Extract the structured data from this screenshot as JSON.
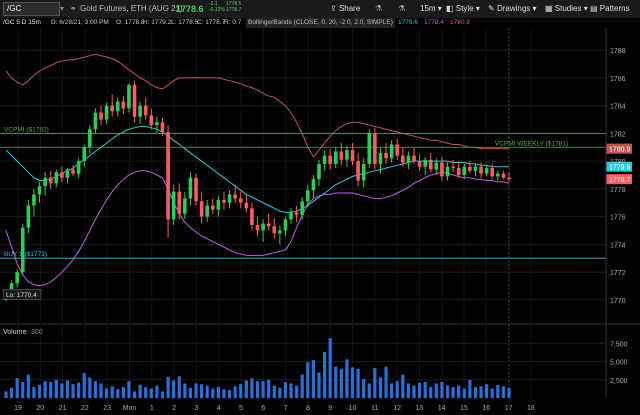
{
  "toolbar": {
    "symbol": "/GC",
    "description": "Gold Futures, ETH (AUG 21)",
    "last_price": "1778.6",
    "change_top": "-2.1",
    "change_bottom": "-0.12%",
    "bid": "1778.5",
    "ask": "1778.7",
    "share_label": "Share",
    "interval_label": "15m",
    "style_label": "Style",
    "drawings_label": "Drawings",
    "studies_label": "Studies",
    "patterns_label": "Patterns"
  },
  "ohlc_bar": {
    "symbol_interval": "/GC 5 D 15m",
    "date": "D: 6/28/21, 3:00 PM",
    "open": "O: 1778.8",
    "high": "H: 1779.2",
    "low": "L: 1778.5",
    "close": "C: 1778.7",
    "range": "R: 0.7",
    "study": "BollingerBands (CLOSE, 0, 20, -2.0, 2.0, SIMPLE)",
    "bb_mid": "1779.6",
    "bb_low": "1778.4",
    "bb_up": "1780.9"
  },
  "colors": {
    "up": "#2ecc52",
    "down": "#ff5d5d",
    "upper_band": "#c0574f",
    "mid_band": "#30c8d8",
    "lower_band": "#c060e0",
    "vcpmi": "#5fae3a",
    "buy_line": "#30c8d8",
    "volume": "#2c6fd6"
  },
  "chart_data": {
    "type": "candlestick",
    "yaxis_ticks": [
      1770,
      1772,
      1774,
      1776,
      1778,
      1780,
      1782,
      1784,
      1786,
      1788
    ],
    "ylim": [
      1768.4,
      1789.6
    ],
    "xaxis_ticks": [
      "19",
      "20",
      "21",
      "22",
      "23",
      "Mon",
      "1",
      "2",
      "3",
      "4",
      "5",
      "6",
      "7",
      "8",
      "9",
      "10",
      "11",
      "12",
      "13",
      "14",
      "15",
      "16",
      "17",
      "18"
    ],
    "levels": [
      {
        "label": "VCPMI ($1782)",
        "value": 1782
      },
      {
        "label": "VCPMI WEEKLY ($1781)",
        "value": 1781
      },
      {
        "label": "BUY 1 ($1773)",
        "value": 1773
      }
    ],
    "low_label": "Lo: 1770.4",
    "low_value": 1770.4,
    "price_tags": [
      {
        "value": 1780.9,
        "text": "1780.9",
        "color": "#c0574f"
      },
      {
        "value": 1779.6,
        "text": "1779.6",
        "color": "#30c8d8"
      },
      {
        "value": 1778.7,
        "text": "1778.7",
        "color": "#ff5d5d"
      }
    ],
    "candles": [
      [
        1770.0,
        1770.8,
        1769.9,
        1770.6
      ],
      [
        1770.6,
        1771.4,
        1770.4,
        1771.2
      ],
      [
        1771.2,
        1772.2,
        1770.9,
        1772.0
      ],
      [
        1772.0,
        1775.5,
        1771.8,
        1775.2
      ],
      [
        1775.2,
        1777.2,
        1774.8,
        1776.8
      ],
      [
        1776.8,
        1778.0,
        1776.0,
        1777.6
      ],
      [
        1777.6,
        1778.5,
        1777.0,
        1778.2
      ],
      [
        1778.2,
        1779.2,
        1777.5,
        1778.8
      ],
      [
        1778.8,
        1779.3,
        1778.0,
        1778.4
      ],
      [
        1778.4,
        1779.4,
        1778.1,
        1779.2
      ],
      [
        1779.2,
        1779.6,
        1778.5,
        1778.8
      ],
      [
        1778.8,
        1779.5,
        1778.4,
        1779.4
      ],
      [
        1779.4,
        1779.7,
        1778.9,
        1779.1
      ],
      [
        1779.1,
        1780.2,
        1778.8,
        1780.0
      ],
      [
        1780.0,
        1781.2,
        1779.6,
        1781.0
      ],
      [
        1781.0,
        1782.6,
        1780.5,
        1782.3
      ],
      [
        1782.3,
        1783.8,
        1782.0,
        1783.5
      ],
      [
        1783.5,
        1784.0,
        1782.6,
        1783.0
      ],
      [
        1783.0,
        1784.2,
        1782.7,
        1784.0
      ],
      [
        1784.0,
        1784.8,
        1783.2,
        1783.6
      ],
      [
        1783.6,
        1784.6,
        1783.2,
        1784.3
      ],
      [
        1784.3,
        1784.7,
        1783.4,
        1783.8
      ],
      [
        1783.8,
        1785.6,
        1783.5,
        1785.5
      ],
      [
        1785.5,
        1785.8,
        1782.8,
        1783.2
      ],
      [
        1783.2,
        1784.3,
        1782.7,
        1784.0
      ],
      [
        1784.0,
        1784.6,
        1783.0,
        1783.3
      ],
      [
        1783.3,
        1783.8,
        1782.3,
        1782.6
      ],
      [
        1782.6,
        1783.2,
        1782.0,
        1782.8
      ],
      [
        1782.8,
        1783.1,
        1781.8,
        1782.1
      ],
      [
        1782.1,
        1782.6,
        1774.5,
        1775.8
      ],
      [
        1775.8,
        1778.3,
        1775.4,
        1777.8
      ],
      [
        1777.8,
        1778.4,
        1775.8,
        1776.2
      ],
      [
        1776.2,
        1777.8,
        1775.8,
        1777.3
      ],
      [
        1777.3,
        1779.2,
        1776.8,
        1778.8
      ],
      [
        1778.8,
        1779.1,
        1776.8,
        1777.1
      ],
      [
        1777.1,
        1777.8,
        1775.5,
        1776.0
      ],
      [
        1776.0,
        1777.2,
        1775.6,
        1776.8
      ],
      [
        1776.8,
        1777.3,
        1776.2,
        1776.5
      ],
      [
        1776.5,
        1777.5,
        1776.0,
        1777.2
      ],
      [
        1777.2,
        1777.8,
        1776.5,
        1777.0
      ],
      [
        1777.0,
        1777.9,
        1776.6,
        1777.6
      ],
      [
        1777.6,
        1778.3,
        1777.0,
        1777.3
      ],
      [
        1777.3,
        1777.8,
        1776.6,
        1777.0
      ],
      [
        1777.0,
        1777.6,
        1776.3,
        1776.6
      ],
      [
        1776.6,
        1777.0,
        1775.0,
        1775.4
      ],
      [
        1775.4,
        1776.0,
        1774.6,
        1775.0
      ],
      [
        1775.0,
        1775.8,
        1774.2,
        1775.5
      ],
      [
        1775.5,
        1776.2,
        1775.0,
        1775.3
      ],
      [
        1775.3,
        1775.9,
        1774.4,
        1774.8
      ],
      [
        1774.8,
        1775.4,
        1774.0,
        1775.0
      ],
      [
        1775.0,
        1776.0,
        1774.6,
        1775.8
      ],
      [
        1775.8,
        1776.6,
        1775.5,
        1776.3
      ],
      [
        1776.3,
        1776.8,
        1775.6,
        1776.1
      ],
      [
        1776.1,
        1777.4,
        1775.8,
        1777.1
      ],
      [
        1777.1,
        1778.3,
        1776.7,
        1777.9
      ],
      [
        1777.9,
        1779.0,
        1777.3,
        1778.7
      ],
      [
        1778.7,
        1780.1,
        1778.2,
        1779.8
      ],
      [
        1779.8,
        1780.8,
        1779.3,
        1780.4
      ],
      [
        1780.4,
        1780.9,
        1779.4,
        1779.8
      ],
      [
        1779.8,
        1781.0,
        1779.5,
        1780.7
      ],
      [
        1780.7,
        1781.3,
        1779.7,
        1780.1
      ],
      [
        1780.1,
        1781.1,
        1779.6,
        1780.8
      ],
      [
        1780.8,
        1781.3,
        1779.7,
        1780.0
      ],
      [
        1780.0,
        1780.6,
        1778.2,
        1778.6
      ],
      [
        1778.6,
        1780.2,
        1778.1,
        1779.8
      ],
      [
        1779.8,
        1782.3,
        1779.5,
        1782.0
      ],
      [
        1782.0,
        1782.4,
        1779.4,
        1779.8
      ],
      [
        1779.8,
        1781.0,
        1779.1,
        1780.6
      ],
      [
        1780.6,
        1781.3,
        1779.8,
        1780.2
      ],
      [
        1780.2,
        1781.5,
        1779.9,
        1781.2
      ],
      [
        1781.2,
        1781.6,
        1780.1,
        1780.4
      ],
      [
        1780.4,
        1781.0,
        1779.6,
        1779.9
      ],
      [
        1779.9,
        1780.7,
        1779.4,
        1780.4
      ],
      [
        1780.4,
        1781.0,
        1779.8,
        1780.0
      ],
      [
        1780.0,
        1780.5,
        1779.3,
        1779.6
      ],
      [
        1779.6,
        1780.3,
        1779.0,
        1780.1
      ],
      [
        1780.1,
        1780.6,
        1779.2,
        1779.4
      ],
      [
        1779.4,
        1780.2,
        1779.0,
        1779.9
      ],
      [
        1779.9,
        1780.3,
        1778.6,
        1778.9
      ],
      [
        1778.9,
        1779.9,
        1778.6,
        1779.6
      ],
      [
        1779.6,
        1780.1,
        1779.2,
        1779.5
      ],
      [
        1779.5,
        1780.0,
        1778.8,
        1779.0
      ],
      [
        1779.0,
        1779.8,
        1778.7,
        1779.6
      ],
      [
        1779.6,
        1780.0,
        1779.1,
        1779.3
      ],
      [
        1779.3,
        1779.8,
        1778.9,
        1779.6
      ],
      [
        1779.6,
        1779.9,
        1778.8,
        1779.1
      ],
      [
        1779.1,
        1779.7,
        1778.9,
        1779.5
      ],
      [
        1779.5,
        1779.8,
        1778.7,
        1778.9
      ],
      [
        1778.9,
        1779.3,
        1778.6,
        1779.1
      ],
      [
        1779.1,
        1779.3,
        1778.7,
        1778.8
      ],
      [
        1778.8,
        1779.2,
        1778.5,
        1778.7
      ]
    ],
    "upper_band": [
      1786.5,
      1786.0,
      1785.7,
      1785.5,
      1785.8,
      1786.2,
      1786.5,
      1786.7,
      1786.9,
      1787.1,
      1787.2,
      1787.3,
      1787.3,
      1787.4,
      1787.5,
      1787.6,
      1787.7,
      1787.6,
      1787.5,
      1787.4,
      1787.2,
      1786.9,
      1786.6,
      1786.3,
      1786.0,
      1785.8,
      1785.5,
      1785.3,
      1785.2,
      1785.5,
      1785.8,
      1786.0,
      1786.0,
      1786.0,
      1786.0,
      1786.0,
      1786.0,
      1786.0,
      1786.0,
      1785.9,
      1785.8,
      1785.7,
      1785.6,
      1785.4,
      1785.3,
      1785.1,
      1784.9,
      1784.7,
      1784.6,
      1784.3,
      1784.0,
      1783.5,
      1782.8,
      1782.0,
      1781.0,
      1780.3,
      1780.8,
      1781.3,
      1781.8,
      1782.2,
      1782.5,
      1782.7,
      1782.8,
      1782.8,
      1782.7,
      1782.6,
      1782.5,
      1782.4,
      1782.3,
      1782.2,
      1782.1,
      1782.0,
      1781.9,
      1781.8,
      1781.7,
      1781.6,
      1781.5,
      1781.5,
      1781.4,
      1781.3,
      1781.2,
      1781.2,
      1781.1,
      1781.0,
      1781.0,
      1780.9,
      1780.9,
      1780.9,
      1780.9,
      1780.9,
      1780.9
    ],
    "mid_band": [
      1780.8,
      1780.4,
      1780.0,
      1779.6,
      1779.2,
      1778.8,
      1778.6,
      1778.6,
      1778.7,
      1778.9,
      1779.1,
      1779.3,
      1779.5,
      1779.8,
      1780.1,
      1780.4,
      1780.7,
      1781.0,
      1781.3,
      1781.6,
      1781.9,
      1782.1,
      1782.3,
      1782.4,
      1782.5,
      1782.5,
      1782.4,
      1782.3,
      1782.1,
      1781.8,
      1781.5,
      1781.2,
      1780.9,
      1780.6,
      1780.3,
      1780.0,
      1779.7,
      1779.4,
      1779.1,
      1778.8,
      1778.5,
      1778.2,
      1777.9,
      1777.6,
      1777.4,
      1777.2,
      1777.0,
      1776.8,
      1776.6,
      1776.4,
      1776.3,
      1776.3,
      1776.4,
      1776.6,
      1776.8,
      1777.1,
      1777.4,
      1777.7,
      1778.0,
      1778.3,
      1778.5,
      1778.7,
      1778.9,
      1779.0,
      1779.1,
      1779.2,
      1779.3,
      1779.4,
      1779.5,
      1779.6,
      1779.7,
      1779.8,
      1779.9,
      1780.0,
      1780.0,
      1780.0,
      1780.0,
      1780.0,
      1780.0,
      1780.0,
      1779.9,
      1779.9,
      1779.9,
      1779.8,
      1779.8,
      1779.7,
      1779.7,
      1779.6,
      1779.6,
      1779.6,
      1779.6
    ],
    "lower_band": [
      1775.0,
      1773.8,
      1772.6,
      1771.8,
      1771.3,
      1771.1,
      1771.0,
      1771.1,
      1771.3,
      1771.6,
      1772.0,
      1772.4,
      1772.9,
      1773.5,
      1774.2,
      1775.0,
      1775.8,
      1776.5,
      1777.2,
      1777.8,
      1778.3,
      1778.7,
      1779.0,
      1779.2,
      1779.3,
      1779.3,
      1779.2,
      1779.0,
      1778.8,
      1778.0,
      1777.0,
      1776.2,
      1775.6,
      1775.2,
      1774.9,
      1774.6,
      1774.4,
      1774.2,
      1774.0,
      1773.8,
      1773.6,
      1773.4,
      1773.3,
      1773.2,
      1773.2,
      1773.2,
      1773.2,
      1773.3,
      1773.4,
      1773.5,
      1773.6,
      1774.2,
      1775.2,
      1776.1,
      1776.9,
      1777.3,
      1777.5,
      1777.6,
      1777.6,
      1777.7,
      1777.7,
      1777.7,
      1777.7,
      1777.6,
      1777.5,
      1777.4,
      1777.3,
      1777.3,
      1777.4,
      1777.5,
      1777.7,
      1777.9,
      1778.1,
      1778.4,
      1778.6,
      1778.8,
      1779.0,
      1779.1,
      1779.2,
      1779.1,
      1779.0,
      1778.9,
      1778.8,
      1778.8,
      1778.7,
      1778.7,
      1778.6,
      1778.6,
      1778.5,
      1778.5,
      1778.4
    ],
    "volume_label": "Volume",
    "volume_sub": "300",
    "volume_ticks": [
      2500,
      5000,
      7500
    ],
    "volume_ylim": [
      0,
      8500
    ],
    "volumes": [
      900,
      1400,
      2700,
      2200,
      3200,
      1500,
      1800,
      2300,
      2200,
      2500,
      2000,
      2400,
      1900,
      2100,
      3400,
      2800,
      2300,
      2000,
      1300,
      1600,
      1200,
      1500,
      2300,
      900,
      1800,
      1500,
      1300,
      1700,
      900,
      2900,
      2400,
      3000,
      2000,
      1400,
      2000,
      1900,
      1700,
      1300,
      1500,
      1200,
      1100,
      1600,
      1900,
      2400,
      2700,
      2300,
      2300,
      2500,
      1700,
      1400,
      2200,
      2000,
      1700,
      3200,
      4900,
      5200,
      3500,
      6300,
      8200,
      4300,
      4000,
      5300,
      4200,
      4000,
      2600,
      2000,
      4100,
      2800,
      4300,
      2000,
      2300,
      3200,
      2000,
      1700,
      2100,
      2200,
      1500,
      2000,
      2200,
      1700,
      1500,
      1700,
      1300,
      2500,
      1500,
      1600,
      1900,
      1300,
      1800,
      1600,
      1400
    ]
  }
}
